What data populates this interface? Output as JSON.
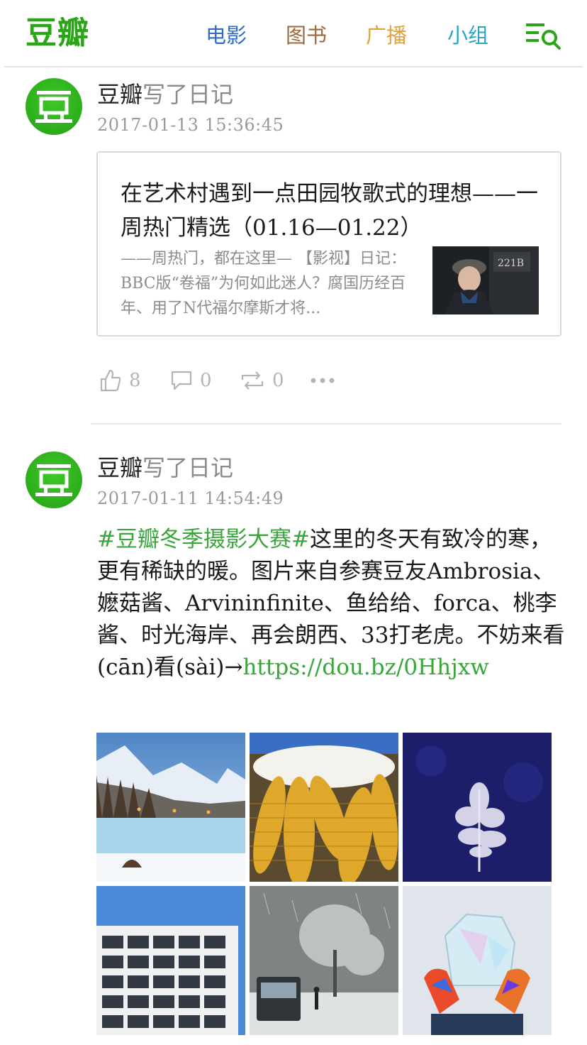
{
  "header": {
    "logo": "豆瓣",
    "nav": [
      {
        "label": "电影",
        "color": "#2e6ac8"
      },
      {
        "label": "图书",
        "color": "#9b6a3a"
      },
      {
        "label": "广播",
        "color": "#e0a23a"
      },
      {
        "label": "小组",
        "color": "#2ba3c4"
      }
    ],
    "menu_icon": "menu-search-icon",
    "brand_color": "#2aa515"
  },
  "feed": [
    {
      "author": "豆瓣",
      "action": "写了日记",
      "time": "2017-01-13 15:36:45",
      "card": {
        "title": "在艺术村遇到一点田园牧歌式的理想——一周热门精选（01.16—01.22）",
        "excerpt": "——周热门，都在这里— 【影视】日记：BBC版“卷福”为何如此迷人？腐国历经百年、用了N代福尔摩斯才将...",
        "thumb_caption": "221B"
      },
      "stats": {
        "likes": "8",
        "comments": "0",
        "reshares": "0"
      }
    },
    {
      "author": "豆瓣",
      "action": "写了日记",
      "time": "2017-01-11 14:54:49",
      "hashtag": "#豆瓣冬季摄影大赛#",
      "text": "这里的冬天有致冷的寒，更有稀缺的暖。图片来自参赛豆友Ambrosia、嬷菇酱、Arvininfinite、鱼给给、forca、桃李酱、时光海岸、再会朗西、33打老虎。不妨来看(cān)看(sài)→",
      "link": "https://dou.bz/0Hhjxw",
      "photos": [
        "mountain-lake-photo",
        "corn-snow-photo",
        "frost-tree-photo",
        "apartment-building-photo",
        "snowy-tram-photo",
        "ice-gloves-photo"
      ]
    }
  ]
}
